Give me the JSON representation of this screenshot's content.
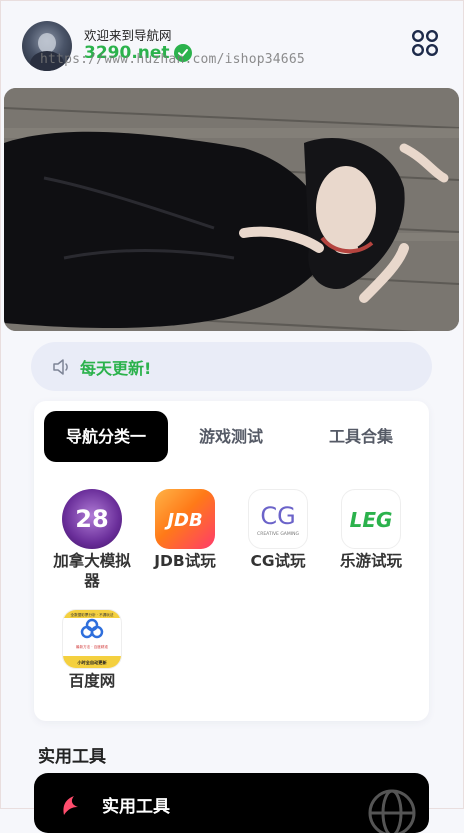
{
  "header": {
    "welcome": "欢迎来到导航网",
    "site_name": "3290.net",
    "watermark": "https://www.huzhan.com/ishop34665",
    "menu_icon": "grid-dots-icon"
  },
  "banner": {
    "image": "photo-banner"
  },
  "notice": {
    "icon": "speaker-icon",
    "text": "每天更新!"
  },
  "tabs": [
    {
      "label": "导航分类一",
      "active": true
    },
    {
      "label": "游戏测试",
      "active": false
    },
    {
      "label": "工具合集",
      "active": false
    }
  ],
  "items": [
    {
      "label": "加拿大模拟器",
      "icon": "jnd-logo-icon",
      "logo_text": "28"
    },
    {
      "label": "JDB试玩",
      "icon": "jdb-logo-icon",
      "logo_text": "JDB"
    },
    {
      "label": "CG试玩",
      "icon": "cg-logo-icon",
      "logo_text": "CG",
      "logo_sub": "CREATIVE GAMING"
    },
    {
      "label": "乐游试玩",
      "icon": "leg-logo-icon",
      "logo_text": "LEG"
    },
    {
      "label": "百度网",
      "icon": "baidu-logo-icon",
      "logo_top": "全数据彩票分析 · 不漏玩法",
      "logo_mid": "最新方法 · 百度精准",
      "logo_bottom": "小时全自动更新"
    }
  ],
  "tools": {
    "section_title": "实用工具",
    "card_title": "实用工具",
    "globe_icon": "globe-icon"
  }
}
